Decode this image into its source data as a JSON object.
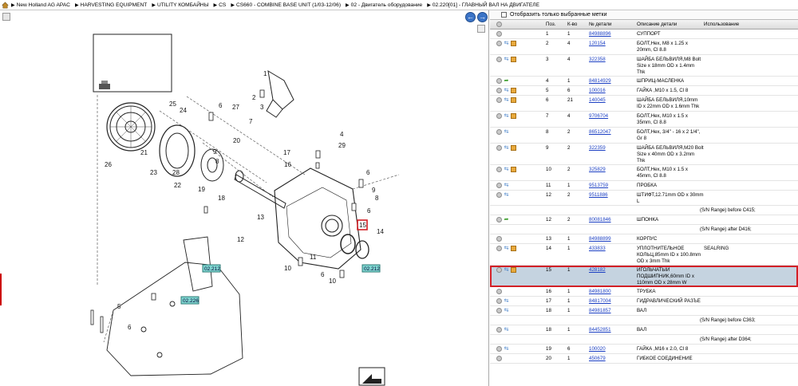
{
  "breadcrumb": [
    "New Holland AG APAC",
    "HARVESTING EQUIPMENT",
    "UTILITY КОМБАЙНЫ",
    "CS",
    "CS660 - COMBINE BASE UNIT (1/03-12/06)",
    "02 - Двигатель оборудование",
    "02.220[01] - ГЛАВНЫЙ ВАЛ НА ДВИГАТЕЛЕ"
  ],
  "filter_label": "Отобразить только выбранные метки",
  "columns": [
    "Поз.",
    "К-во",
    "№ детали",
    "Описание детали",
    "Использование"
  ],
  "drawing": {
    "callouts": [
      "1",
      "2",
      "3",
      "4",
      "5",
      "6",
      "7",
      "8",
      "9",
      "10",
      "11",
      "12",
      "13",
      "14",
      "15",
      "16",
      "17",
      "18",
      "19",
      "20",
      "21",
      "22",
      "23",
      "24",
      "25",
      "26",
      "27",
      "28",
      "29"
    ],
    "ref_tags": [
      "02.212",
      "02.212",
      "02.226"
    ]
  },
  "rows": [
    {
      "icons": "c",
      "pos": "1",
      "qty": "1",
      "part": "84988896",
      "desc": "СУППОРТ",
      "use": ""
    },
    {
      "icons": "csb",
      "pos": "2",
      "qty": "4",
      "part": "120154",
      "desc": "БОЛТ,Hex, M8 x 1.25 x 20mm, Cl 8.8",
      "use": ""
    },
    {
      "icons": "csb",
      "pos": "3",
      "qty": "4",
      "part": "322358",
      "desc": "ШАЙБА БЕЛЬВИЛЯ,M8 Bolt Size x 18mm OD x 1.4mm Thk",
      "use": ""
    },
    {
      "icons": "cg",
      "pos": "4",
      "qty": "1",
      "part": "84814929",
      "desc": "ШПРИЦ-МАСЛЕНКА",
      "use": ""
    },
    {
      "icons": "csb",
      "pos": "5",
      "qty": "6",
      "part": "100016",
      "desc": "ГАЙКА ,M10 x 1.5, Cl 8",
      "use": ""
    },
    {
      "icons": "csb",
      "pos": "6",
      "qty": "21",
      "part": "140045",
      "desc": "ШАЙБА БЕЛЬВИЛЯ,10mm ID x 22mm OD x 1.6mm Thk",
      "use": ""
    },
    {
      "icons": "csb",
      "pos": "7",
      "qty": "4",
      "part": "9706704",
      "desc": "БОЛТ,Hex, M10 x 1.5 x 35mm, Cl 8.8",
      "use": ""
    },
    {
      "icons": "cs",
      "pos": "8",
      "qty": "2",
      "part": "86512047",
      "desc": "БОЛТ,Hex, 3/4\" - 16 x 2 1/4\", Gr 8",
      "use": ""
    },
    {
      "icons": "csb",
      "pos": "9",
      "qty": "2",
      "part": "322359",
      "desc": "ШАЙБА БЕЛЬВИЛЯ,M20 Bolt Size x 40mm OD x 3.2mm Thk",
      "use": ""
    },
    {
      "icons": "csb",
      "pos": "10",
      "qty": "2",
      "part": "325829",
      "desc": "БОЛТ,Hex, M10 x 1.5 x 45mm, Cl 8.8",
      "use": ""
    },
    {
      "icons": "cs",
      "pos": "11",
      "qty": "1",
      "part": "9513759",
      "desc": "ПРОБКА",
      "use": ""
    },
    {
      "icons": "cs",
      "pos": "12",
      "qty": "2",
      "part": "9511886",
      "desc": "ШТИФТ,12.71mm OD x 30mm L",
      "use": "",
      "note": "(S/N Range) before C415;"
    },
    {
      "icons": "cg",
      "pos": "12",
      "qty": "2",
      "part": "80081846",
      "desc": "ШПОНКА",
      "use": "",
      "note": "(S/N Range) after D416;"
    },
    {
      "icons": "c",
      "pos": "13",
      "qty": "1",
      "part": "84988899",
      "desc": "КОРПУС",
      "use": ""
    },
    {
      "icons": "csb",
      "pos": "14",
      "qty": "1",
      "part": "433833",
      "desc": "УПЛОТНИТЕЛЬНОЕ КОЛЬЦ,85mm ID x 100.8mm OD x 3mm Thk",
      "use": "SEALRING"
    },
    {
      "icons": "csb",
      "pos": "15",
      "qty": "1",
      "part": "428182",
      "desc": "ИГОЛЬЧАТЫЙ ПОДШИПНИК,60mm ID x 110mm OD x 28mm W",
      "use": "",
      "sel": true
    },
    {
      "icons": "c",
      "pos": "16",
      "qty": "1",
      "part": "84981800",
      "desc": "ТРУБКА",
      "use": ""
    },
    {
      "icons": "cs",
      "pos": "17",
      "qty": "1",
      "part": "84817004",
      "desc": "ГИДРАВЛИЧЕСКИЙ РАЗЪЕ",
      "use": ""
    },
    {
      "icons": "cs",
      "pos": "18",
      "qty": "1",
      "part": "84981857",
      "desc": "ВАЛ",
      "use": "",
      "note": "(S/N Range) before C363;"
    },
    {
      "icons": "cs",
      "pos": "18",
      "qty": "1",
      "part": "84452851",
      "desc": "ВАЛ",
      "use": "",
      "note": "(S/N Range) after D364;"
    },
    {
      "icons": "cs",
      "pos": "19",
      "qty": "6",
      "part": "100020",
      "desc": "ГАЙКА ,M16 x 2.0, Cl 8",
      "use": ""
    },
    {
      "icons": "c",
      "pos": "20",
      "qty": "1",
      "part": "450679",
      "desc": "ГИБКОЕ СОЕДИНЕНИЕ",
      "use": ""
    }
  ]
}
